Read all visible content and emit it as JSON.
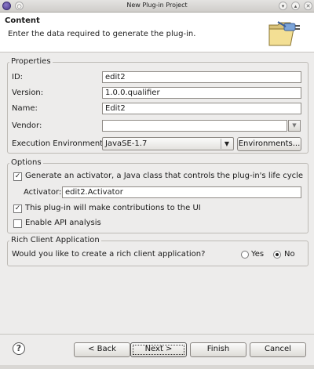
{
  "window": {
    "title": "New Plug-in Project"
  },
  "header": {
    "title": "Content",
    "description": "Enter the data required to generate the plug-in."
  },
  "properties": {
    "legend": "Properties",
    "id_label": "ID:",
    "id_value": "edit2",
    "version_label": "Version:",
    "version_value": "1.0.0.qualifier",
    "name_label": "Name:",
    "name_value": "Edit2",
    "vendor_label": "Vendor:",
    "vendor_value": "",
    "exec_env_label": "Execution Environment:",
    "exec_env_value": "JavaSE-1.7",
    "environments_button": "Environments..."
  },
  "options": {
    "legend": "Options",
    "generate_activator_label": "Generate an activator, a Java class that controls the plug-in's life cycle",
    "generate_activator_checked": true,
    "activator_label": "Activator:",
    "activator_value": "edit2.Activator",
    "contributions_label": "This plug-in will make contributions to the UI",
    "contributions_checked": true,
    "api_analysis_label": "Enable API analysis",
    "api_analysis_checked": false
  },
  "rcp": {
    "legend": "Rich Client Application",
    "question": "Would you like to create a rich client application?",
    "yes_label": "Yes",
    "no_label": "No",
    "selected": "No"
  },
  "footer": {
    "back_button": "< Back",
    "next_button": "Next >",
    "finish_button": "Finish",
    "cancel_button": "Cancel"
  },
  "colors": {
    "background": "#edeceb",
    "header_bg": "#ffffff",
    "border": "#bdbab5"
  }
}
